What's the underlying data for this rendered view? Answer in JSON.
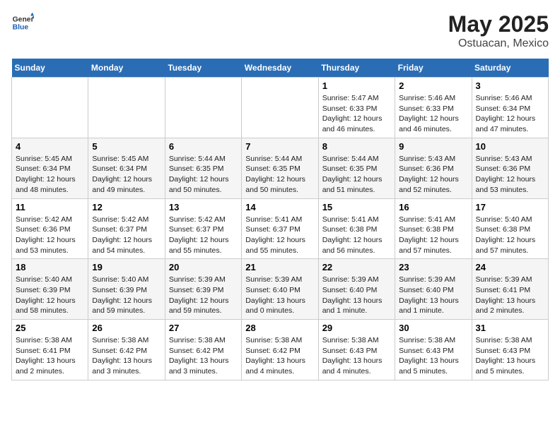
{
  "logo": {
    "general": "General",
    "blue": "Blue"
  },
  "title": "May 2025",
  "subtitle": "Ostuacan, Mexico",
  "days_of_week": [
    "Sunday",
    "Monday",
    "Tuesday",
    "Wednesday",
    "Thursday",
    "Friday",
    "Saturday"
  ],
  "weeks": [
    [
      {
        "num": "",
        "info": ""
      },
      {
        "num": "",
        "info": ""
      },
      {
        "num": "",
        "info": ""
      },
      {
        "num": "",
        "info": ""
      },
      {
        "num": "1",
        "info": "Sunrise: 5:47 AM\nSunset: 6:33 PM\nDaylight: 12 hours\nand 46 minutes."
      },
      {
        "num": "2",
        "info": "Sunrise: 5:46 AM\nSunset: 6:33 PM\nDaylight: 12 hours\nand 46 minutes."
      },
      {
        "num": "3",
        "info": "Sunrise: 5:46 AM\nSunset: 6:34 PM\nDaylight: 12 hours\nand 47 minutes."
      }
    ],
    [
      {
        "num": "4",
        "info": "Sunrise: 5:45 AM\nSunset: 6:34 PM\nDaylight: 12 hours\nand 48 minutes."
      },
      {
        "num": "5",
        "info": "Sunrise: 5:45 AM\nSunset: 6:34 PM\nDaylight: 12 hours\nand 49 minutes."
      },
      {
        "num": "6",
        "info": "Sunrise: 5:44 AM\nSunset: 6:35 PM\nDaylight: 12 hours\nand 50 minutes."
      },
      {
        "num": "7",
        "info": "Sunrise: 5:44 AM\nSunset: 6:35 PM\nDaylight: 12 hours\nand 50 minutes."
      },
      {
        "num": "8",
        "info": "Sunrise: 5:44 AM\nSunset: 6:35 PM\nDaylight: 12 hours\nand 51 minutes."
      },
      {
        "num": "9",
        "info": "Sunrise: 5:43 AM\nSunset: 6:36 PM\nDaylight: 12 hours\nand 52 minutes."
      },
      {
        "num": "10",
        "info": "Sunrise: 5:43 AM\nSunset: 6:36 PM\nDaylight: 12 hours\nand 53 minutes."
      }
    ],
    [
      {
        "num": "11",
        "info": "Sunrise: 5:42 AM\nSunset: 6:36 PM\nDaylight: 12 hours\nand 53 minutes."
      },
      {
        "num": "12",
        "info": "Sunrise: 5:42 AM\nSunset: 6:37 PM\nDaylight: 12 hours\nand 54 minutes."
      },
      {
        "num": "13",
        "info": "Sunrise: 5:42 AM\nSunset: 6:37 PM\nDaylight: 12 hours\nand 55 minutes."
      },
      {
        "num": "14",
        "info": "Sunrise: 5:41 AM\nSunset: 6:37 PM\nDaylight: 12 hours\nand 55 minutes."
      },
      {
        "num": "15",
        "info": "Sunrise: 5:41 AM\nSunset: 6:38 PM\nDaylight: 12 hours\nand 56 minutes."
      },
      {
        "num": "16",
        "info": "Sunrise: 5:41 AM\nSunset: 6:38 PM\nDaylight: 12 hours\nand 57 minutes."
      },
      {
        "num": "17",
        "info": "Sunrise: 5:40 AM\nSunset: 6:38 PM\nDaylight: 12 hours\nand 57 minutes."
      }
    ],
    [
      {
        "num": "18",
        "info": "Sunrise: 5:40 AM\nSunset: 6:39 PM\nDaylight: 12 hours\nand 58 minutes."
      },
      {
        "num": "19",
        "info": "Sunrise: 5:40 AM\nSunset: 6:39 PM\nDaylight: 12 hours\nand 59 minutes."
      },
      {
        "num": "20",
        "info": "Sunrise: 5:39 AM\nSunset: 6:39 PM\nDaylight: 12 hours\nand 59 minutes."
      },
      {
        "num": "21",
        "info": "Sunrise: 5:39 AM\nSunset: 6:40 PM\nDaylight: 13 hours\nand 0 minutes."
      },
      {
        "num": "22",
        "info": "Sunrise: 5:39 AM\nSunset: 6:40 PM\nDaylight: 13 hours\nand 1 minute."
      },
      {
        "num": "23",
        "info": "Sunrise: 5:39 AM\nSunset: 6:40 PM\nDaylight: 13 hours\nand 1 minute."
      },
      {
        "num": "24",
        "info": "Sunrise: 5:39 AM\nSunset: 6:41 PM\nDaylight: 13 hours\nand 2 minutes."
      }
    ],
    [
      {
        "num": "25",
        "info": "Sunrise: 5:38 AM\nSunset: 6:41 PM\nDaylight: 13 hours\nand 2 minutes."
      },
      {
        "num": "26",
        "info": "Sunrise: 5:38 AM\nSunset: 6:42 PM\nDaylight: 13 hours\nand 3 minutes."
      },
      {
        "num": "27",
        "info": "Sunrise: 5:38 AM\nSunset: 6:42 PM\nDaylight: 13 hours\nand 3 minutes."
      },
      {
        "num": "28",
        "info": "Sunrise: 5:38 AM\nSunset: 6:42 PM\nDaylight: 13 hours\nand 4 minutes."
      },
      {
        "num": "29",
        "info": "Sunrise: 5:38 AM\nSunset: 6:43 PM\nDaylight: 13 hours\nand 4 minutes."
      },
      {
        "num": "30",
        "info": "Sunrise: 5:38 AM\nSunset: 6:43 PM\nDaylight: 13 hours\nand 5 minutes."
      },
      {
        "num": "31",
        "info": "Sunrise: 5:38 AM\nSunset: 6:43 PM\nDaylight: 13 hours\nand 5 minutes."
      }
    ]
  ]
}
